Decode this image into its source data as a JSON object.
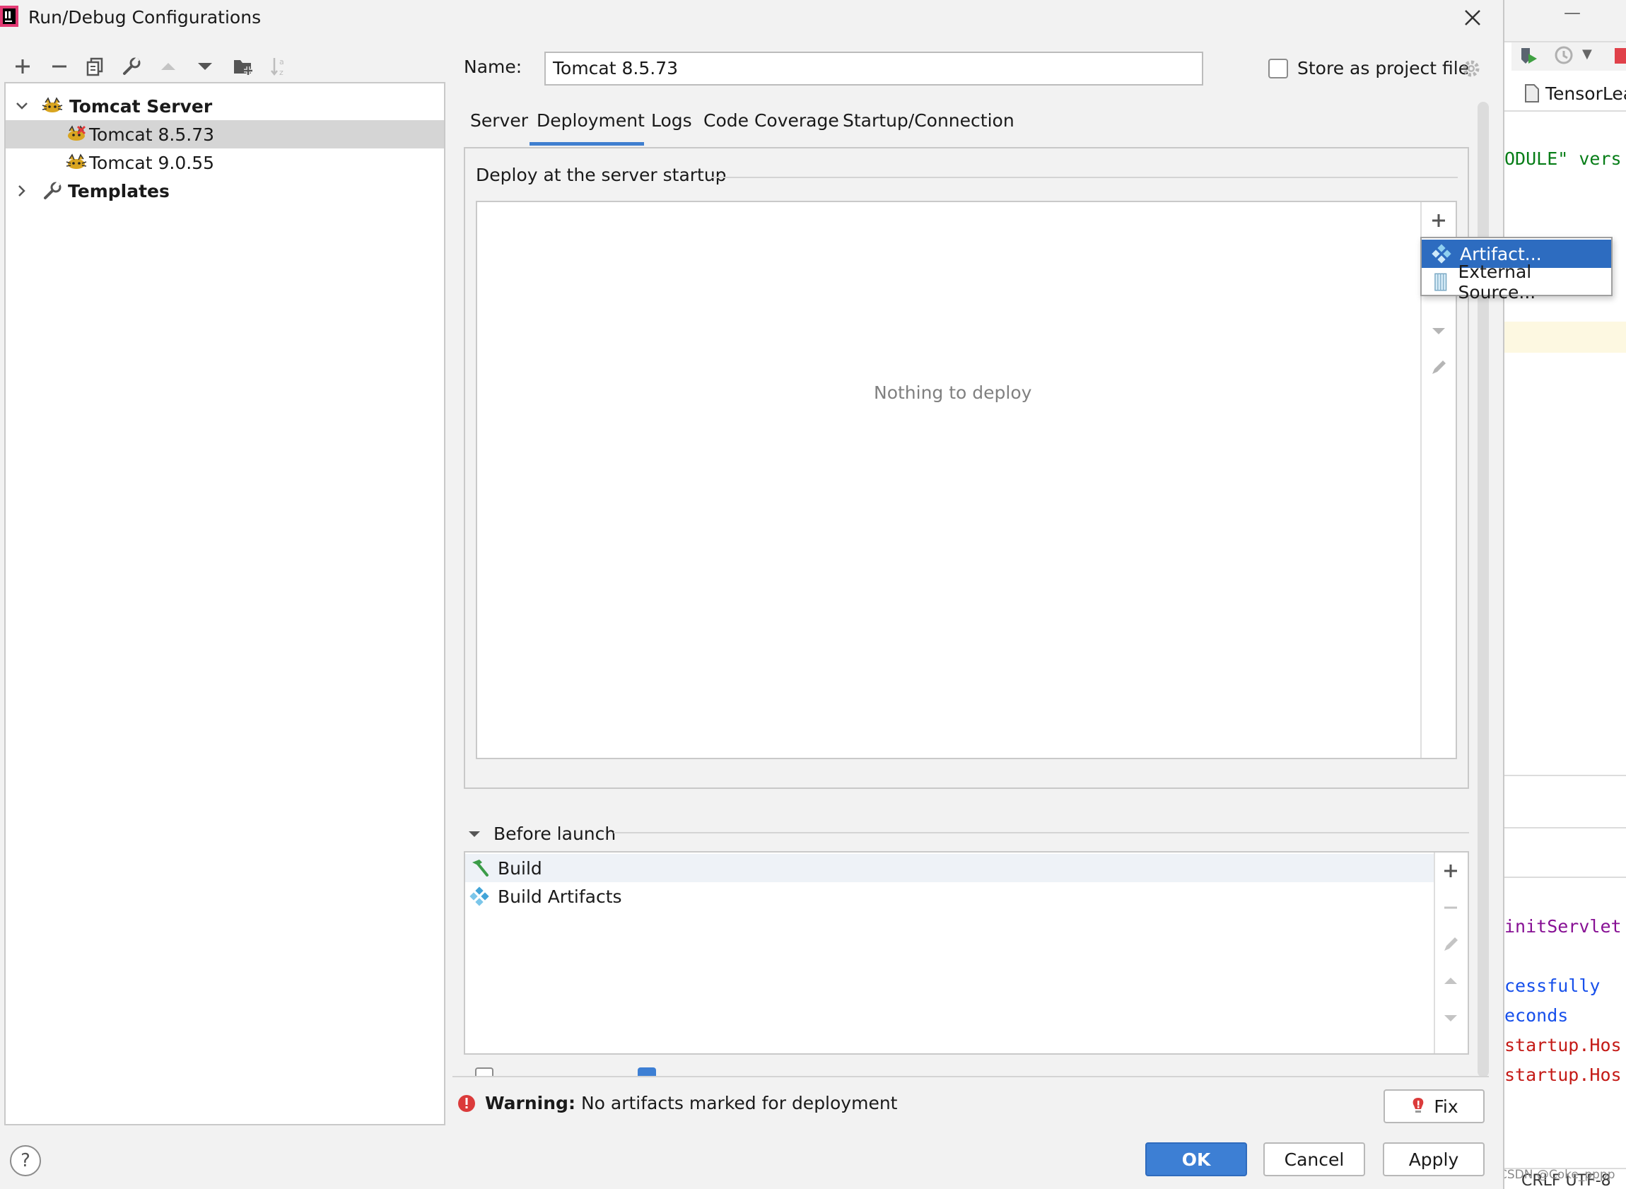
{
  "window": {
    "title": "Run/Debug Configurations"
  },
  "toolbar": {
    "add": "add-icon",
    "remove": "remove-icon",
    "copy": "copy-icon",
    "edit_templates": "wrench-icon",
    "move_up": "arrow-up-icon",
    "move_down": "arrow-down-icon",
    "new_folder": "folder-add-icon",
    "sort": "sort-alpha-icon"
  },
  "tree": {
    "groups": [
      {
        "label": "Tomcat Server",
        "expanded": true,
        "children": [
          {
            "label": "Tomcat 8.5.73",
            "selected": true
          },
          {
            "label": "Tomcat 9.0.55",
            "selected": false
          }
        ]
      },
      {
        "label": "Templates",
        "expanded": false
      }
    ]
  },
  "form": {
    "name_label": "Name:",
    "name_value": "Tomcat 8.5.73",
    "store_label": "Store as project file",
    "store_checked": false
  },
  "tabs": [
    {
      "label": "Server",
      "active": false
    },
    {
      "label": "Deployment",
      "active": true
    },
    {
      "label": "Logs",
      "active": false
    },
    {
      "label": "Code Coverage",
      "active": false
    },
    {
      "label": "Startup/Connection",
      "active": false
    }
  ],
  "deployment": {
    "group_title": "Deploy at the server startup",
    "empty_text": "Nothing to deploy",
    "popup_items": [
      {
        "label": "Artifact...",
        "icon": "artifact-icon",
        "selected": true
      },
      {
        "label": "External Source...",
        "icon": "external-source-icon",
        "selected": false
      }
    ]
  },
  "before_launch": {
    "title": "Before launch",
    "items": [
      {
        "label": "Build",
        "icon": "hammer-icon"
      },
      {
        "label": "Build Artifacts",
        "icon": "artifact-icon"
      }
    ]
  },
  "warning": {
    "bold": "Warning:",
    "text": "No artifacts marked for deployment"
  },
  "buttons": {
    "fix": "Fix",
    "ok": "OK",
    "cancel": "Cancel",
    "apply": "Apply",
    "help": "?"
  },
  "ide": {
    "tab_label": "TensorLea",
    "code_lines": [
      {
        "text": "ODULE\" vers",
        "color": "#067d17"
      },
      {
        "text": "initServlet",
        "color": "#871094"
      },
      {
        "text": "cessfully",
        "color": "#1750eb"
      },
      {
        "text": "econds",
        "color": "#1750eb"
      },
      {
        "text": "startup.Hos",
        "color": "#c41a16"
      },
      {
        "text": "startup.Hos",
        "color": "#c41a16"
      }
    ],
    "status_text": "CRLF  UTF-8",
    "watermark": "CSDN @Coke_pppp"
  }
}
